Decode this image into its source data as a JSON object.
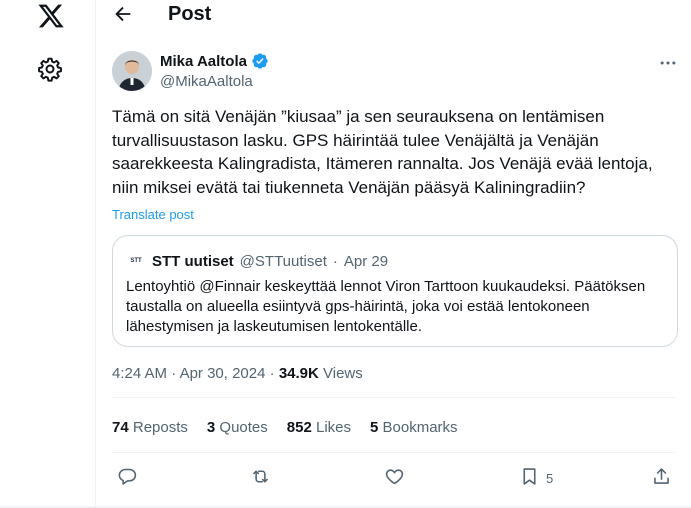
{
  "header": {
    "title": "Post"
  },
  "author": {
    "name": "Mika Aaltola",
    "handle": "@MikaAaltola"
  },
  "tweet": {
    "text": "Tämä on sitä Venäjän ”kiusaa” ja sen seurauksena on lentämisen\nturvallisuustason lasku. GPS häirintää tulee Venäjältä ja Venäjän\nsaarekkeesta Kalingradista, Itämeren rannalta. Jos Venäjä evää lentoja,\nniin miksei evätä tai tiukenneta Venäjän pääsyä Kaliningradiin?",
    "translate_label": "Translate post"
  },
  "quote": {
    "avatar_text": "STT",
    "name": "STT uutiset",
    "handle": "@STTuutiset",
    "separator": "·",
    "date": "Apr 29",
    "text": "Lentoyhtiö @Finnair keskeyttää lennot Viron Tarttoon kuukaudeksi. Päätöksen taustalla on alueella esiintyvä gps-häirintä, joka voi estää lentokoneen lähestymisen ja laskeutumisen lentokentälle."
  },
  "meta": {
    "time": "4:24 AM",
    "separator": "·",
    "date": "Apr 30, 2024",
    "separator2": "·",
    "views_count": "34.9K",
    "views_label": "Views"
  },
  "stats": {
    "reposts_count": "74",
    "reposts_label": "Reposts",
    "quotes_count": "3",
    "quotes_label": "Quotes",
    "likes_count": "852",
    "likes_label": "Likes",
    "bookmarks_count": "5",
    "bookmarks_label": "Bookmarks"
  },
  "actions": {
    "bookmark_count": "5"
  },
  "icons": [
    "x-logo-icon",
    "gear-icon",
    "back-arrow-icon",
    "verified-badge-icon",
    "more-icon",
    "reply-icon",
    "repost-icon",
    "like-icon",
    "bookmark-icon",
    "share-icon"
  ],
  "colors": {
    "accent": "#1d9bf0",
    "text": "#0f1419",
    "secondary": "#536471",
    "border": "#cfd9de"
  }
}
